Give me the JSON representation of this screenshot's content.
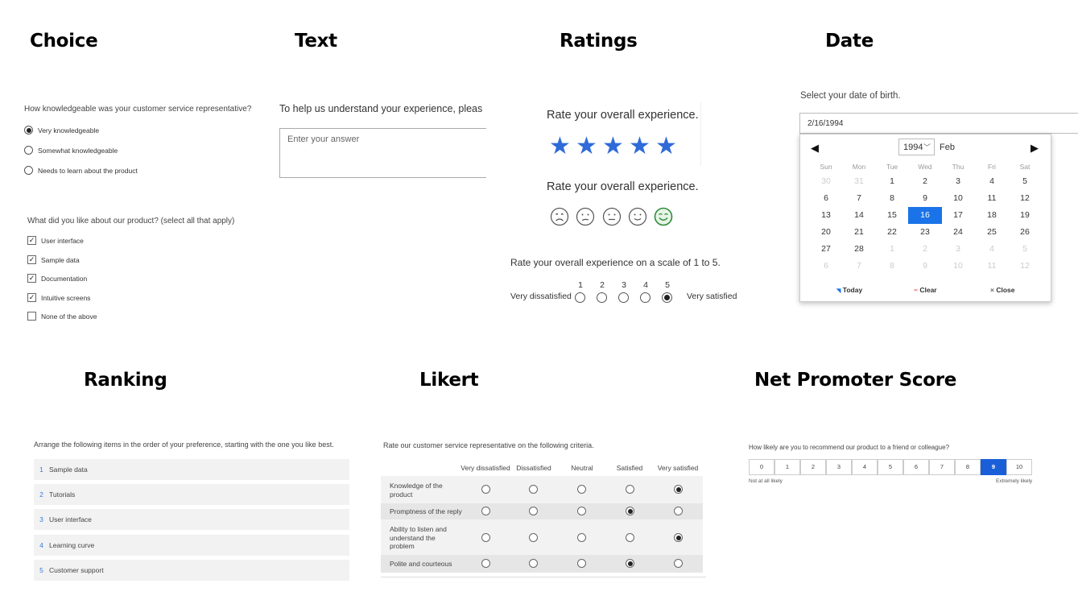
{
  "headings": {
    "choice": "Choice",
    "text": "Text",
    "ratings": "Ratings",
    "date": "Date",
    "ranking": "Ranking",
    "likert": "Likert",
    "nps": "Net Promoter Score"
  },
  "choice": {
    "single_question": "How knowledgeable was your customer service representative?",
    "single_options": [
      {
        "label": "Very knowledgeable",
        "selected": true
      },
      {
        "label": "Somewhat knowledgeable",
        "selected": false
      },
      {
        "label": "Needs to learn about the product",
        "selected": false
      }
    ],
    "multi_question": "What did you like about our product? (select all that apply)",
    "multi_options": [
      {
        "label": "User interface",
        "checked": true
      },
      {
        "label": "Sample data",
        "checked": true
      },
      {
        "label": "Documentation",
        "checked": true
      },
      {
        "label": "Intuitive screens",
        "checked": true
      },
      {
        "label": "None of the above",
        "checked": false
      }
    ]
  },
  "text": {
    "question": "To help us understand your experience, pleas",
    "placeholder": "Enter your answer"
  },
  "ratings": {
    "star_question": "Rate your overall experience.",
    "star_count": 5,
    "star_value": 5,
    "smiley_question": "Rate your overall experience.",
    "smiley_selected": 5,
    "scale_question": "Rate your overall experience on a scale of 1 to 5.",
    "scale_numbers": [
      "1",
      "2",
      "3",
      "4",
      "5"
    ],
    "scale_selected": 5,
    "scale_low_label": "Very dissatisfied",
    "scale_high_label": "Very satisfied",
    "accent_color": "#2f6bd8"
  },
  "date": {
    "question": "Select your date of birth.",
    "value": "2/16/1994",
    "year": "1994",
    "month": "Feb",
    "weekdays": [
      "Sun",
      "Mon",
      "Tue",
      "Wed",
      "Thu",
      "Fri",
      "Sat"
    ],
    "weeks": [
      [
        [
          "30",
          true
        ],
        [
          "31",
          true
        ],
        [
          "1",
          false
        ],
        [
          "2",
          false
        ],
        [
          "3",
          false
        ],
        [
          "4",
          false
        ],
        [
          "5",
          false
        ]
      ],
      [
        [
          "6",
          false
        ],
        [
          "7",
          false
        ],
        [
          "8",
          false
        ],
        [
          "9",
          false
        ],
        [
          "10",
          false
        ],
        [
          "11",
          false
        ],
        [
          "12",
          false
        ]
      ],
      [
        [
          "13",
          false
        ],
        [
          "14",
          false
        ],
        [
          "15",
          false
        ],
        [
          "16",
          false
        ],
        [
          "17",
          false
        ],
        [
          "18",
          false
        ],
        [
          "19",
          false
        ]
      ],
      [
        [
          "20",
          false
        ],
        [
          "21",
          false
        ],
        [
          "22",
          false
        ],
        [
          "23",
          false
        ],
        [
          "24",
          false
        ],
        [
          "25",
          false
        ],
        [
          "26",
          false
        ]
      ],
      [
        [
          "27",
          false
        ],
        [
          "28",
          false
        ],
        [
          "1",
          true
        ],
        [
          "2",
          true
        ],
        [
          "3",
          true
        ],
        [
          "4",
          true
        ],
        [
          "5",
          true
        ]
      ],
      [
        [
          "6",
          true
        ],
        [
          "7",
          true
        ],
        [
          "8",
          true
        ],
        [
          "9",
          true
        ],
        [
          "10",
          true
        ],
        [
          "11",
          true
        ],
        [
          "12",
          true
        ]
      ]
    ],
    "selected_day": "16",
    "today_label": "Today",
    "clear_label": "Clear",
    "close_label": "Close",
    "selected_color": "#1a73e8"
  },
  "ranking": {
    "question": "Arrange the following items in the order of your preference, starting with the one you like best.",
    "items": [
      {
        "num": "1",
        "label": "Sample data"
      },
      {
        "num": "2",
        "label": "Tutorials"
      },
      {
        "num": "3",
        "label": "User interface"
      },
      {
        "num": "4",
        "label": "Learning curve"
      },
      {
        "num": "5",
        "label": "Customer support"
      }
    ]
  },
  "likert": {
    "question": "Rate our customer service representative on the following criteria.",
    "columns": [
      "Very dissatisfied",
      "Dissatisfied",
      "Neutral",
      "Satisfied",
      "Very satisfied"
    ],
    "rows": [
      {
        "label": "Knowledge of the product",
        "selected": 4
      },
      {
        "label": "Promptness of the reply",
        "selected": 3
      },
      {
        "label": "Ability to listen and understand the problem",
        "selected": 4
      },
      {
        "label": "Polite and courteous",
        "selected": 3
      }
    ]
  },
  "nps": {
    "question": "How likely are you to recommend our product to a friend or colleague?",
    "scores": [
      "0",
      "1",
      "2",
      "3",
      "4",
      "5",
      "6",
      "7",
      "8",
      "9",
      "10"
    ],
    "selected": "9",
    "low_label": "Not at all likely",
    "high_label": "Extremely likely",
    "selected_color": "#1a5fd8"
  }
}
